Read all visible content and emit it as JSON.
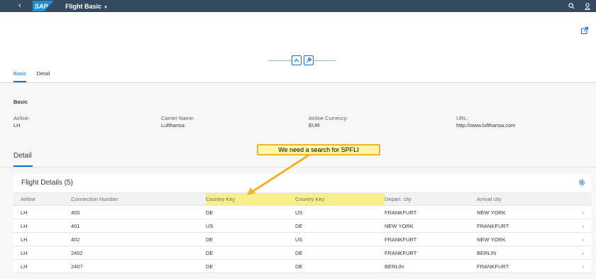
{
  "shell": {
    "back_glyph": "‹",
    "logo_text": "SAP",
    "app_title": "Flight Basic",
    "title_caret": "▼",
    "icons": [
      "search-icon",
      "user-icon"
    ]
  },
  "tabs": [
    {
      "label": "Basic",
      "active": true
    },
    {
      "label": "Detail",
      "active": false
    }
  ],
  "basic": {
    "title": "Basic",
    "fields": [
      {
        "label": "Airline:",
        "value": "LH"
      },
      {
        "label": "Carrier Name:",
        "value": "Lufthansa"
      },
      {
        "label": "Airline Currency:",
        "value": "EUR"
      },
      {
        "label": "URL:",
        "value": "http://www.lufthansa.com"
      }
    ]
  },
  "detail": {
    "title": "Detail",
    "table_title": "Flight Details (5)",
    "columns": [
      "Airline",
      "Connection Number",
      "Country Key",
      "Country Key",
      "Depart. city",
      "Arrival city"
    ],
    "rows": [
      [
        "LH",
        "400",
        "DE",
        "US",
        "FRANKFURT",
        "NEW YORK"
      ],
      [
        "LH",
        "401",
        "US",
        "DE",
        "NEW YORK",
        "FRANKFURT"
      ],
      [
        "LH",
        "402",
        "DE",
        "US",
        "FRANKFURT",
        "NEW YORK"
      ],
      [
        "LH",
        "2402",
        "DE",
        "DE",
        "FRANKFURT",
        "BERLIN"
      ],
      [
        "LH",
        "2407",
        "DE",
        "DE",
        "BERLIN",
        "FRANKFURT"
      ]
    ],
    "row_chevron": "›"
  },
  "annotation": {
    "text": "We need a search for SPFLI"
  },
  "colors": {
    "shell_bg": "#354a5f",
    "accent": "#0a6ed1",
    "highlight": "#f7f08a",
    "callout_border": "#f0b12b"
  }
}
